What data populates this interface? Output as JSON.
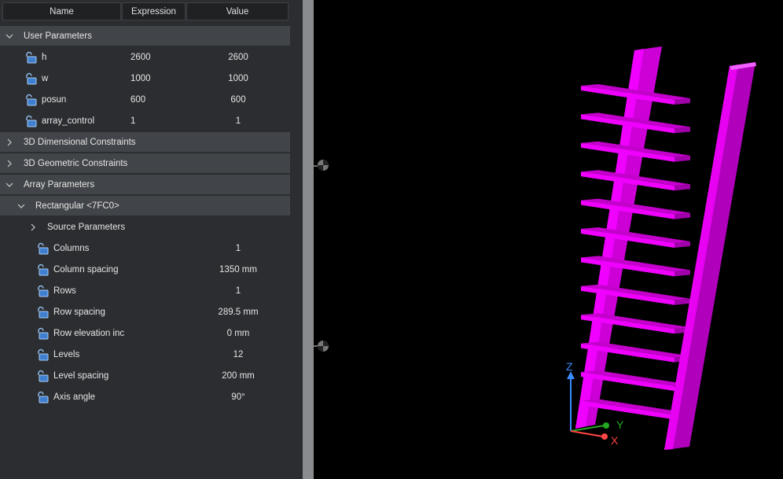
{
  "header": {
    "name": "Name",
    "expression": "Expression",
    "value": "Value"
  },
  "groups": {
    "user_parameters": "User Parameters",
    "dim_constraints": "3D Dimensional Constraints",
    "geo_constraints": "3D Geometric Constraints",
    "array_parameters": "Array Parameters",
    "rectangular": "Rectangular <7FC0>",
    "source_parameters": "Source Parameters"
  },
  "user_params": [
    {
      "name": "h",
      "expression": "2600",
      "value": "2600"
    },
    {
      "name": "w",
      "expression": "1000",
      "value": "1000"
    },
    {
      "name": "posun",
      "expression": "600",
      "value": "600"
    },
    {
      "name": "array_control",
      "expression": "1",
      "value": "1"
    }
  ],
  "array_params": [
    {
      "name": "Columns",
      "value": "1"
    },
    {
      "name": "Column spacing",
      "value": "1350 mm"
    },
    {
      "name": "Rows",
      "value": "1"
    },
    {
      "name": "Row spacing",
      "value": "289.5 mm"
    },
    {
      "name": "Row elevation inc",
      "value": "0 mm"
    },
    {
      "name": "Levels",
      "value": "12"
    },
    {
      "name": "Level spacing",
      "value": "200 mm"
    },
    {
      "name": "Axis angle",
      "value": "90°"
    }
  ],
  "axes": {
    "z": "Z",
    "y": "Y",
    "x": "X"
  },
  "colors": {
    "model": "#e000e6",
    "panel_bg": "#2b2d30",
    "group_bg": "#414448"
  },
  "icons": {
    "lock": "padlock-icon",
    "expand": "chevron-down-icon",
    "collapse": "chevron-right-icon"
  }
}
